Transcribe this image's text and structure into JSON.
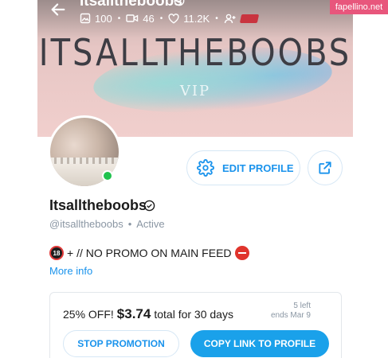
{
  "header": {
    "username": "Itsalltheboobs",
    "stats": {
      "photos": "100",
      "videos": "46",
      "likes": "11.2K"
    },
    "more_icon": "more-vertical-icon"
  },
  "cover": {
    "title": "ITSALLTHEBOOBS",
    "subtitle": "VIP"
  },
  "watermark": "fapellino.net",
  "actions": {
    "edit_label": "EDIT PROFILE"
  },
  "profile": {
    "display_name": "Itsalltheboobs",
    "handle": "@itsalltheboobs",
    "status": "Active",
    "bio_text": "+ // NO PROMO ON MAIN FEED",
    "emoji_18": "18",
    "more_info_label": "More info"
  },
  "promotion": {
    "discount_label": "25% OFF!",
    "price": "$3.74",
    "period_text": "total for 30 days",
    "remaining": "5 left",
    "ends": "ends Mar 9",
    "stop_label": "STOP PROMOTION",
    "copy_label": "COPY LINK TO PROFILE"
  },
  "colors": {
    "accent": "#1a93ec",
    "online": "#20c24e",
    "cover_bg": "#e6c6c4"
  }
}
